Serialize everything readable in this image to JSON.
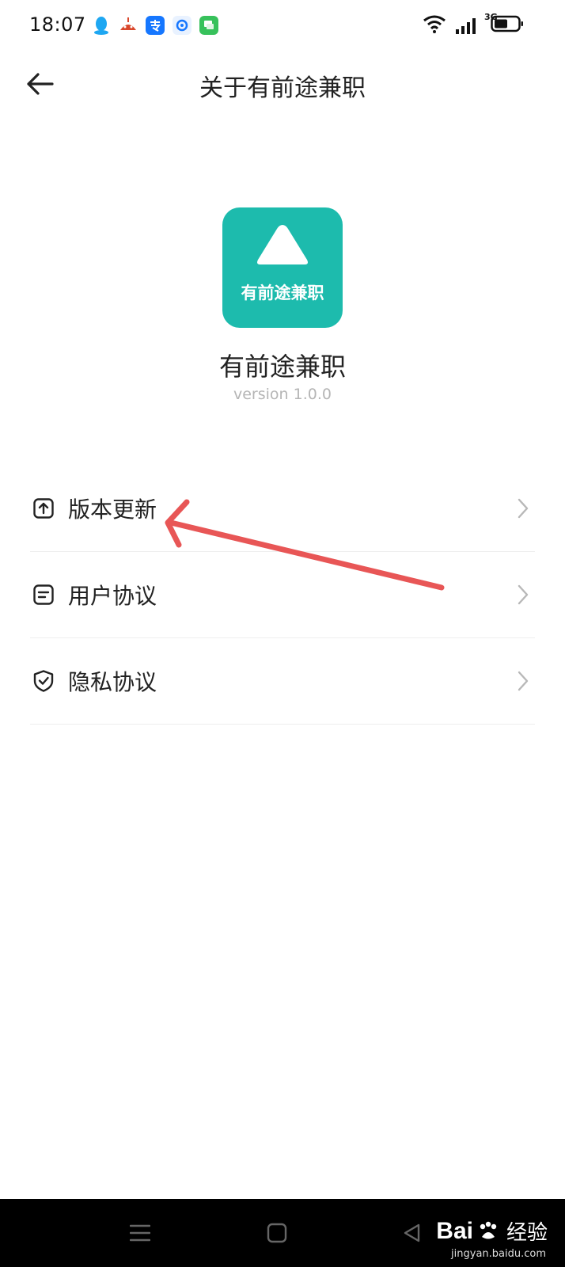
{
  "status_bar": {
    "time": "18:07",
    "network": "3G",
    "notification_icons": [
      "qq-icon",
      "app-icon",
      "alipay-icon",
      "email-icon",
      "message-icon"
    ],
    "colors": {
      "qq": "#1ea7f2",
      "alipay": "#1677ff",
      "messages": "#37c15b"
    }
  },
  "header": {
    "title": "关于有前途兼职",
    "back_icon": "arrow-left-icon"
  },
  "app": {
    "logo_text": "有前途兼职",
    "name": "有前途兼职",
    "version": "version  1.0.0",
    "brand_color": "#1dbbad"
  },
  "menu": {
    "items": [
      {
        "label": "版本更新",
        "icon": "upload-box-icon"
      },
      {
        "label": "用户协议",
        "icon": "document-icon"
      },
      {
        "label": "隐私协议",
        "icon": "shield-check-icon"
      }
    ]
  },
  "annotation": {
    "color": "#e85656",
    "icon": "red-arrow"
  },
  "watermark": {
    "brand": "Bai",
    "brand_suffix": "经验",
    "url": "jingyan.baidu.com"
  }
}
